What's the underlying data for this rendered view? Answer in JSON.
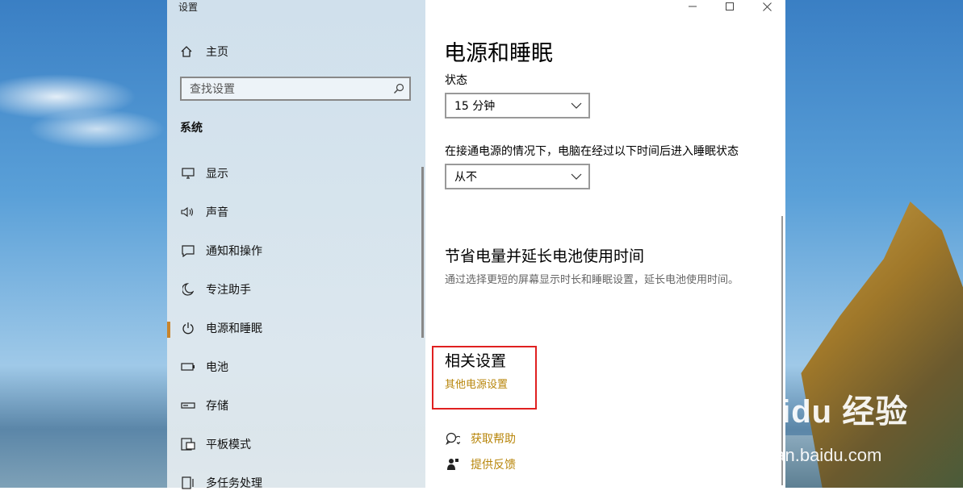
{
  "window": {
    "title": "设置",
    "controls": [
      "minimize",
      "maximize",
      "close"
    ]
  },
  "nav": {
    "home_label": "主页",
    "search_placeholder": "查找设置",
    "section": "系统",
    "items": [
      {
        "label": "显示",
        "icon": "monitor-icon"
      },
      {
        "label": "声音",
        "icon": "speaker-icon"
      },
      {
        "label": "通知和操作",
        "icon": "notification-icon"
      },
      {
        "label": "专注助手",
        "icon": "moon-icon"
      },
      {
        "label": "电源和睡眠",
        "icon": "power-icon",
        "active": true
      },
      {
        "label": "电池",
        "icon": "battery-icon"
      },
      {
        "label": "存储",
        "icon": "storage-icon"
      },
      {
        "label": "平板模式",
        "icon": "tablet-mode-icon"
      },
      {
        "label": "多任务处理",
        "icon": "multitask-icon"
      }
    ]
  },
  "content": {
    "title": "电源和睡眠",
    "screen_label": "状态",
    "screen_value": "15 分钟",
    "sleep_label": "在接通电源的情况下，电脑在经过以下时间后进入睡眠状态",
    "sleep_value": "从不",
    "save_heading": "节省电量并延长电池使用时间",
    "save_desc": "通过选择更短的屏幕显示时长和睡眠设置，延长电池使用时间。",
    "related_heading": "相关设置",
    "related_link": "其他电源设置",
    "help_link": "获取帮助",
    "feedback_link": "提供反馈",
    "accent_color": "#b8860b"
  },
  "watermark": {
    "brand": "Baidu 经验",
    "site": "jingyan.baidu.com"
  }
}
